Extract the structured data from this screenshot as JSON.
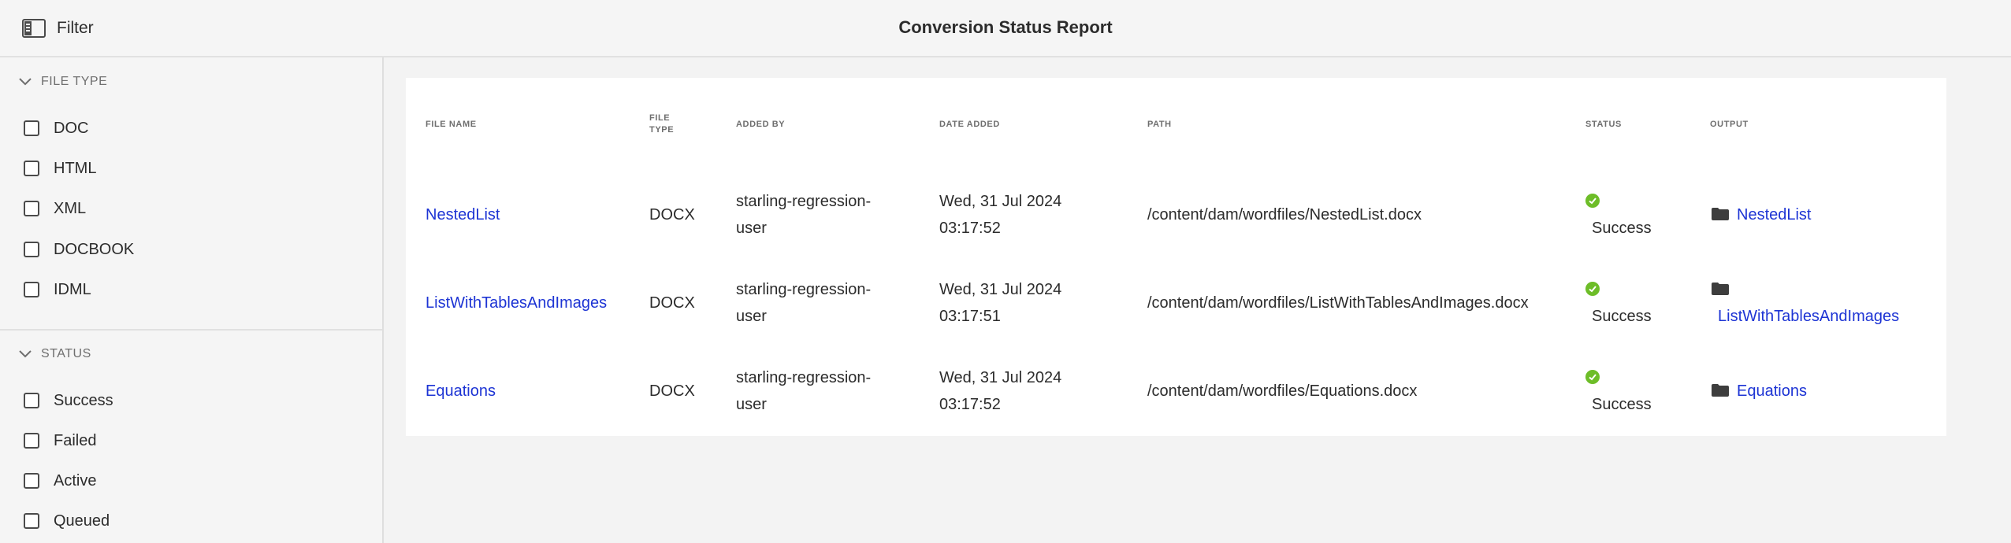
{
  "header": {
    "filter_label": "Filter",
    "title": "Conversion Status Report"
  },
  "sidebar": {
    "file_type": {
      "label": "FILE TYPE",
      "options": [
        "DOC",
        "HTML",
        "XML",
        "DOCBOOK",
        "IDML"
      ]
    },
    "status": {
      "label": "STATUS",
      "options": [
        "Success",
        "Failed",
        "Active",
        "Queued"
      ]
    }
  },
  "table": {
    "columns": {
      "file_name": "FILE NAME",
      "file_type_1": "FILE",
      "file_type_2": "TYPE",
      "added_by": "ADDED BY",
      "date_added": "DATE ADDED",
      "path": "PATH",
      "status": "STATUS",
      "output": "OUTPUT"
    },
    "rows": [
      {
        "file_name": "NestedList",
        "file_type": "DOCX",
        "added_by_1": "starling-regression-",
        "added_by_2": "user",
        "date_1": "Wed, 31 Jul 2024",
        "date_2": "03:17:52",
        "path": "/content/dam/wordfiles/NestedList.docx",
        "status": "Success",
        "output": "NestedList"
      },
      {
        "file_name": "ListWithTablesAndImages",
        "file_type": "DOCX",
        "added_by_1": "starling-regression-",
        "added_by_2": "user",
        "date_1": "Wed, 31 Jul 2024",
        "date_2": "03:17:51",
        "path": "/content/dam/wordfiles/ListWithTablesAndImages.docx",
        "status": "Success",
        "output": "ListWithTablesAndImages"
      },
      {
        "file_name": "Equations",
        "file_type": "DOCX",
        "added_by_1": "starling-regression-",
        "added_by_2": "user",
        "date_1": "Wed, 31 Jul 2024",
        "date_2": "03:17:52",
        "path": "/content/dam/wordfiles/Equations.docx",
        "status": "Success",
        "output": "Equations"
      }
    ]
  },
  "colors": {
    "link": "#1d34d4",
    "success": "#6dbd28",
    "background": "#f3f3f3"
  },
  "icons": {
    "filter": "sidebar-panel-icon",
    "section_toggle": "chevron-down-icon",
    "status": "check-circle-icon",
    "output": "folder-icon"
  }
}
